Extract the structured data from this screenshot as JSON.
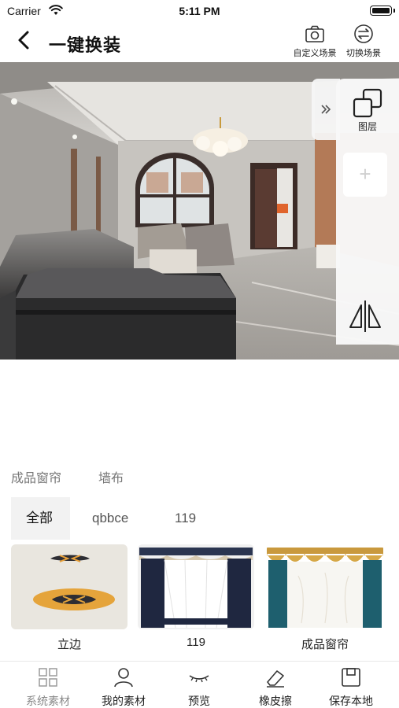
{
  "status_bar": {
    "carrier": "Carrier",
    "time": "5:11 PM"
  },
  "header": {
    "title": "一键换装",
    "custom_scene_label": "自定义场景",
    "switch_scene_label": "切换场景"
  },
  "tool_panel": {
    "layers_label": "图层",
    "add_symbol": "+"
  },
  "categories": [
    {
      "label": "成品窗帘"
    },
    {
      "label": "墙布"
    }
  ],
  "filters": [
    {
      "label": "全部",
      "selected": true
    },
    {
      "label": "qbbce"
    },
    {
      "label": "119"
    }
  ],
  "materials": [
    {
      "name": "立边"
    },
    {
      "name": "119"
    },
    {
      "name": "成品窗帘"
    }
  ],
  "bottom_nav": [
    {
      "label": "系统素材",
      "icon": "grid-icon",
      "disabled": true
    },
    {
      "label": "我的素材",
      "icon": "user-icon"
    },
    {
      "label": "预览",
      "icon": "eye-closed-icon"
    },
    {
      "label": "橡皮擦",
      "icon": "eraser-icon"
    },
    {
      "label": "保存本地",
      "icon": "save-icon"
    }
  ],
  "colors": {
    "accent_text": "#111111",
    "muted_text": "#777777",
    "chip_bg": "#f2f2f2"
  }
}
